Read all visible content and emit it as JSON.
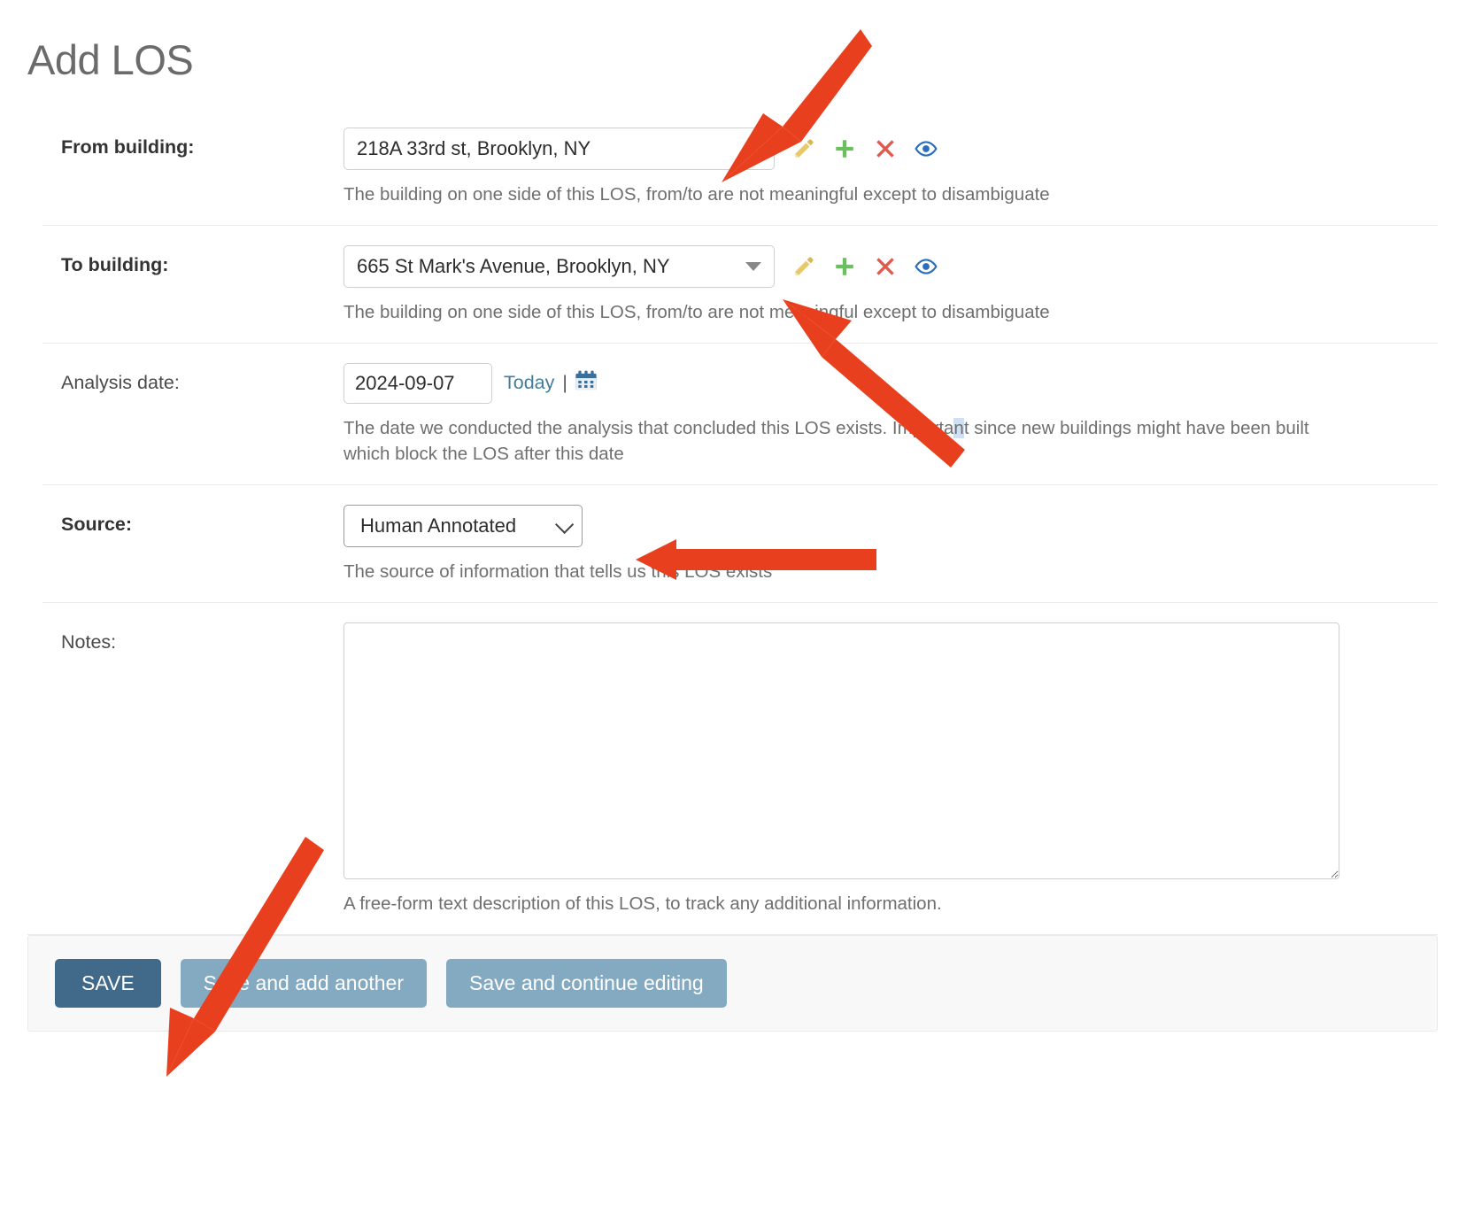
{
  "page": {
    "title": "Add LOS"
  },
  "accent": {
    "annotation_red": "#e8401f",
    "primary_button": "#41698a",
    "secondary_button": "#84aac2",
    "link_blue": "#447e9b",
    "pencil_yellow": "#e8c96a",
    "plus_green": "#6abf5e",
    "x_red": "#e05b4f",
    "eye_blue": "#2a6ebb"
  },
  "fields": {
    "from_building": {
      "label": "From building:",
      "value": "218A 33rd st, Brooklyn, NY",
      "help": "The building on one side of this LOS, from/to are not meaningful except to disambiguate",
      "icons": [
        "pencil-icon",
        "plus-icon",
        "x-icon",
        "eye-icon"
      ]
    },
    "to_building": {
      "label": "To building:",
      "value": "665 St Mark's Avenue, Brooklyn, NY",
      "help": "The building on one side of this LOS, from/to are not meaningful except to disambiguate",
      "icons": [
        "pencil-icon",
        "plus-icon",
        "x-icon",
        "eye-icon"
      ]
    },
    "analysis_date": {
      "label": "Analysis date:",
      "value": "2024-09-07",
      "placeholder": "",
      "today_label": "Today",
      "separator": "|",
      "calendar_icon": "calendar-icon",
      "help_part1": "The date we conducted the analysis that concluded this LOS exists. Importa",
      "help_selected": "n",
      "help_part2": "t since new buildings might have been built which block the LOS after this date"
    },
    "source": {
      "label": "Source:",
      "value": "Human Annotated",
      "help": "The source of information that tells us this LOS exists",
      "options": [
        "Human Annotated"
      ]
    },
    "notes": {
      "label": "Notes:",
      "value": "",
      "placeholder": "",
      "help": "A free-form text description of this LOS, to track any additional information."
    }
  },
  "submit": {
    "save": "SAVE",
    "save_add_another": "Save and add another",
    "save_continue": "Save and continue editing"
  },
  "annotations": [
    {
      "name": "arrow-to-from-building",
      "target": "from-building-select"
    },
    {
      "name": "arrow-to-to-building",
      "target": "to-building-select"
    },
    {
      "name": "arrow-to-source",
      "target": "source-select"
    },
    {
      "name": "arrow-to-save",
      "target": "save-button"
    }
  ]
}
